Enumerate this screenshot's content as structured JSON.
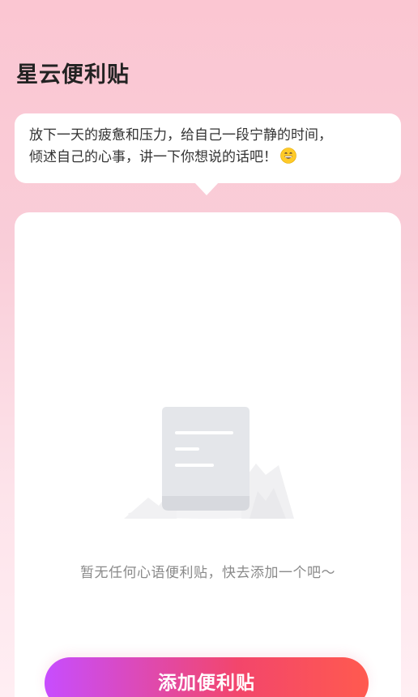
{
  "header": {
    "title": "星云便利贴"
  },
  "bubble": {
    "line1": "放下一天的疲惫和压力，给自己一段宁静的时间，",
    "line2": "倾述自己的心事，讲一下你想说的话吧！",
    "emoji_icon": "grinning-face-icon"
  },
  "empty_state": {
    "icon": "document-icon",
    "message": "暂无任何心语便利贴，快去添加一个吧～"
  },
  "actions": {
    "add_label": "添加便利贴"
  },
  "colors": {
    "background_top": "#fbc6d2",
    "background_bottom": "#ffeef3",
    "button_gradient_start": "#c74dff",
    "button_gradient_end": "#ff5a4f",
    "empty_text": "#8a8a8a"
  }
}
